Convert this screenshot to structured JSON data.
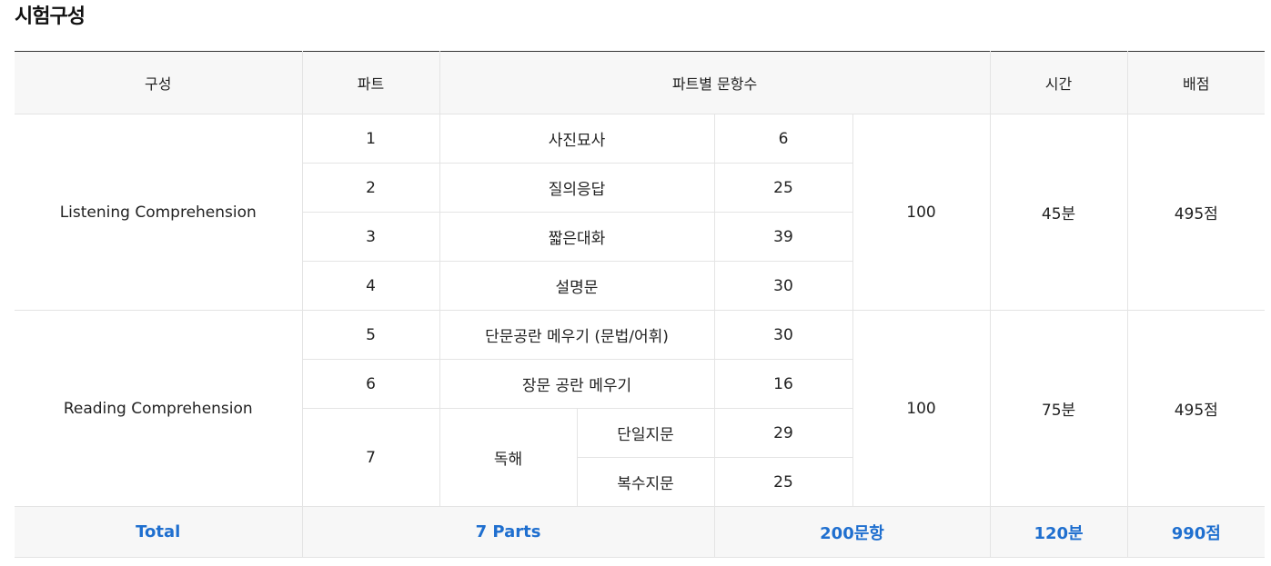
{
  "page": {
    "title": "시험구성"
  },
  "colors": {
    "accent": "#1f6fcf",
    "header_bg": "#f7f7f7"
  },
  "table": {
    "headers": {
      "section": "구성",
      "part": "파트",
      "items_per_part": "파트별 문항수",
      "time": "시간",
      "score": "배점"
    },
    "listening": {
      "name": "Listening Comprehension",
      "parts": [
        {
          "no": "1",
          "name": "사진묘사",
          "count": "6"
        },
        {
          "no": "2",
          "name": "질의응답",
          "count": "25"
        },
        {
          "no": "3",
          "name": "짧은대화",
          "count": "39"
        },
        {
          "no": "4",
          "name": "설명문",
          "count": "30"
        }
      ],
      "total": "100",
      "time": "45분",
      "score": "495점"
    },
    "reading": {
      "name": "Reading Comprehension",
      "parts": [
        {
          "no": "5",
          "name": "단문공란 메우기 (문법/어휘)",
          "count": "30"
        },
        {
          "no": "6",
          "name": "장문 공란 메우기",
          "count": "16"
        },
        {
          "no": "7",
          "name": "독해",
          "sub": [
            {
              "name": "단일지문",
              "count": "29"
            },
            {
              "name": "복수지문",
              "count": "25"
            }
          ]
        }
      ],
      "total": "100",
      "time": "75분",
      "score": "495점"
    },
    "footer": {
      "label": "Total",
      "parts": "7 Parts",
      "items": "200문항",
      "time": "120분",
      "score": "990점"
    }
  }
}
